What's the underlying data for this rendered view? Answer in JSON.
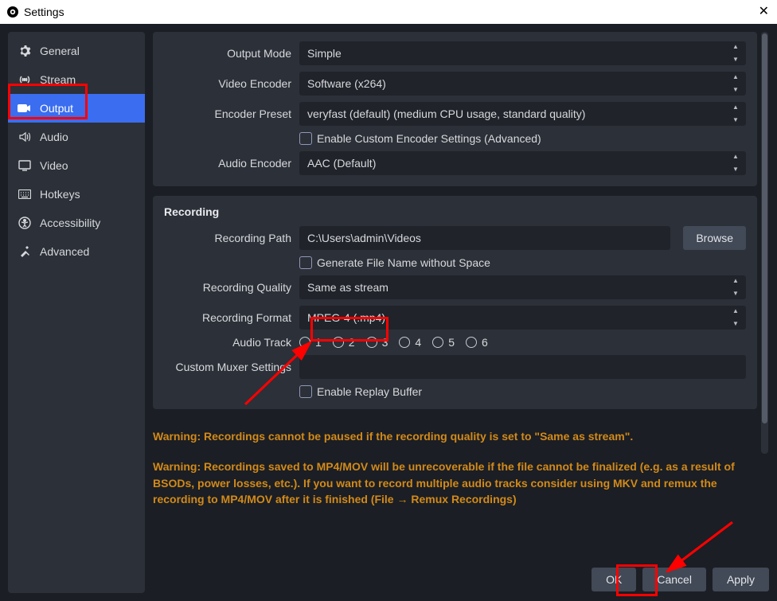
{
  "window": {
    "title": "Settings"
  },
  "sidebar": {
    "items": [
      {
        "label": "General"
      },
      {
        "label": "Stream"
      },
      {
        "label": "Output"
      },
      {
        "label": "Audio"
      },
      {
        "label": "Video"
      },
      {
        "label": "Hotkeys"
      },
      {
        "label": "Accessibility"
      },
      {
        "label": "Advanced"
      }
    ]
  },
  "top": {
    "output_mode_label": "Output Mode",
    "output_mode_value": "Simple",
    "video_encoder_label": "Video Encoder",
    "video_encoder_value": "Software (x264)",
    "encoder_preset_label": "Encoder Preset",
    "encoder_preset_value": "veryfast (default) (medium CPU usage, standard quality)",
    "custom_encoder_label": "Enable Custom Encoder Settings (Advanced)",
    "audio_encoder_label": "Audio Encoder",
    "audio_encoder_value": "AAC (Default)"
  },
  "rec": {
    "section_title": "Recording",
    "path_label": "Recording Path",
    "path_value": "C:\\Users\\admin\\Videos",
    "browse_label": "Browse",
    "gen_filename_label": "Generate File Name without Space",
    "quality_label": "Recording Quality",
    "quality_value": "Same as stream",
    "format_label": "Recording Format",
    "format_value": "MPEG-4 (.mp4)",
    "audio_track_label": "Audio Track",
    "tracks": [
      "1",
      "2",
      "3",
      "4",
      "5",
      "6"
    ],
    "muxer_label": "Custom Muxer Settings",
    "muxer_value": "",
    "replay_label": "Enable Replay Buffer"
  },
  "warnings": {
    "w1": "Warning: Recordings cannot be paused if the recording quality is set to \"Same as stream\".",
    "w2": "Warning: Recordings saved to MP4/MOV will be unrecoverable if the file cannot be finalized (e.g. as a result of BSODs, power losses, etc.). If you want to record multiple audio tracks consider using MKV and remux the recording to MP4/MOV after it is finished (File → Remux Recordings)"
  },
  "buttons": {
    "ok": "OK",
    "cancel": "Cancel",
    "apply": "Apply"
  }
}
